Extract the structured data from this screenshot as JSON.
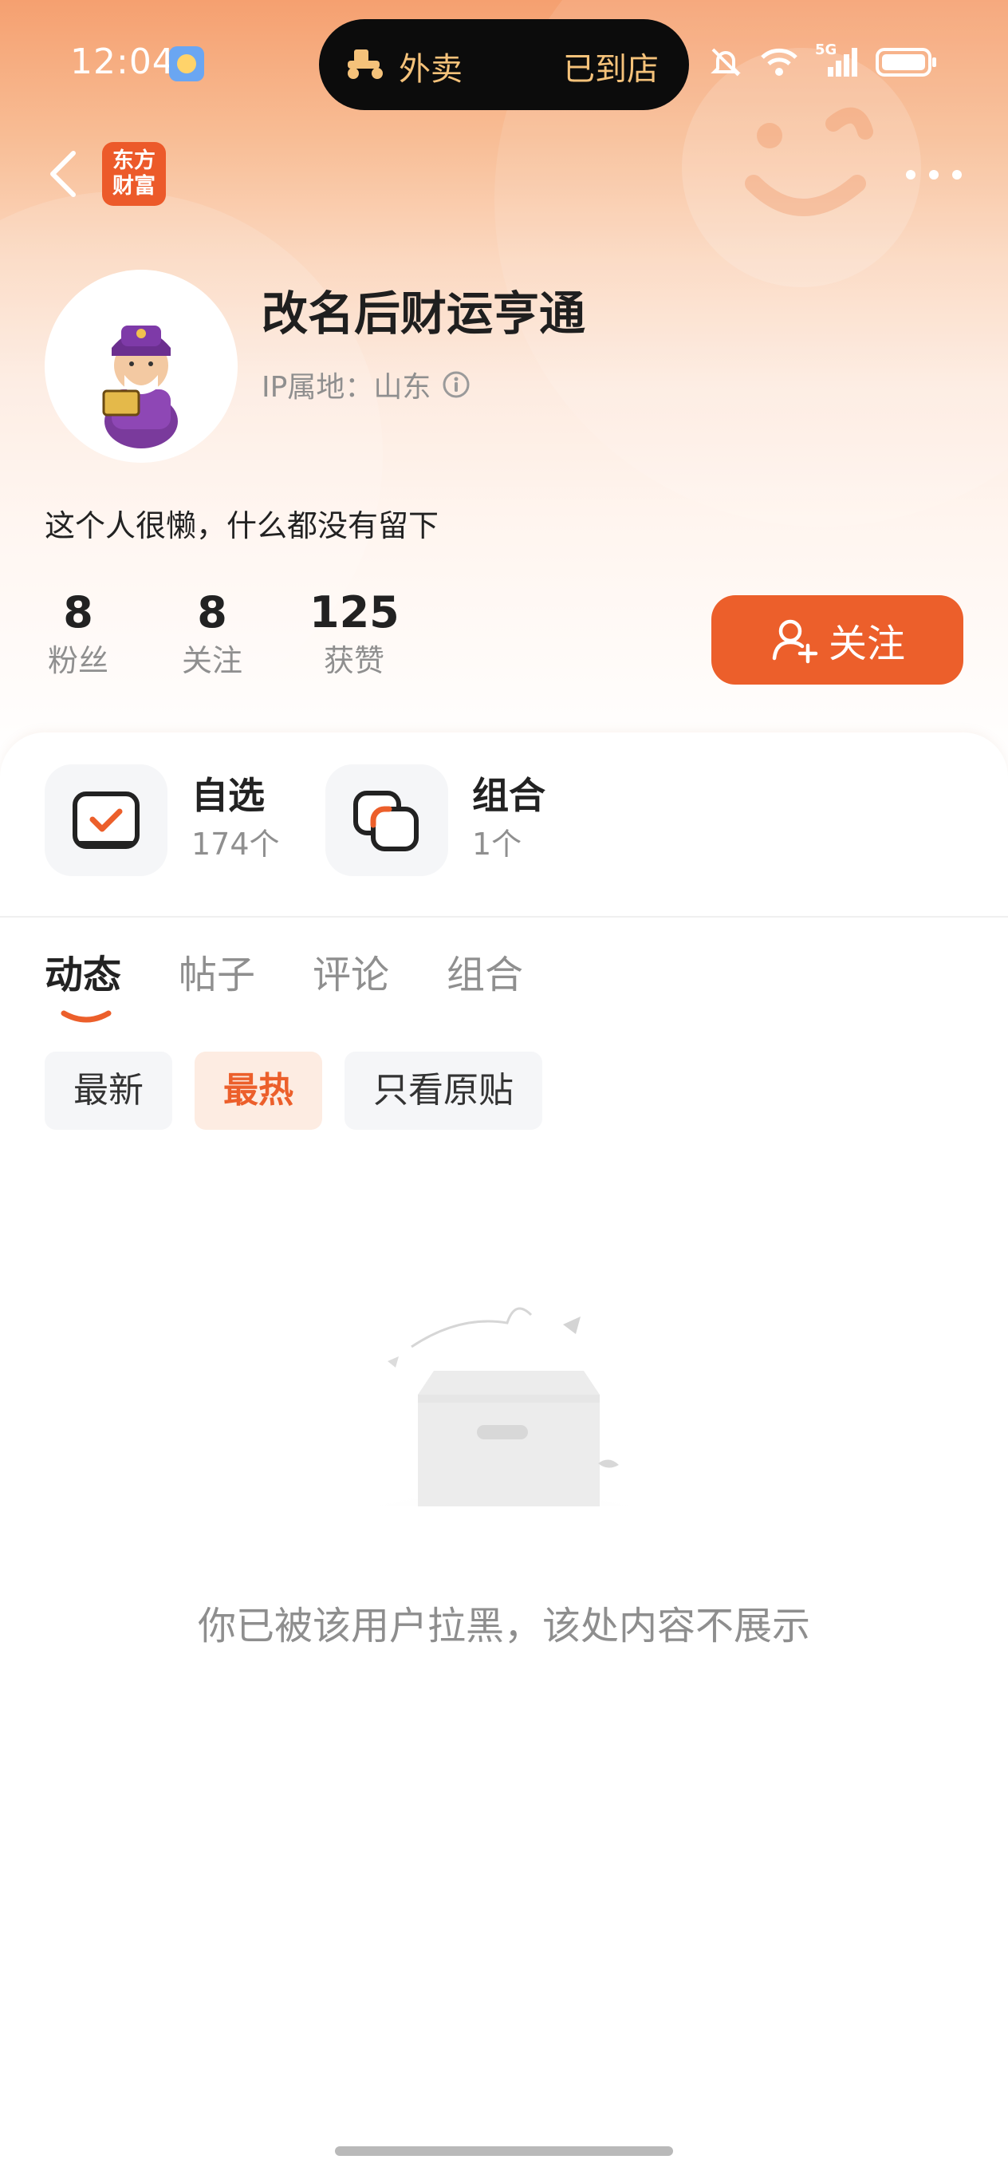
{
  "status_bar": {
    "time": "12:04",
    "island_left": "外卖",
    "island_right": "已到店",
    "network": "5G"
  },
  "nav": {
    "back_icon": "chevron-left-icon",
    "logo_text": "东方财富",
    "more_icon": "more-dots-icon"
  },
  "profile": {
    "username": "改名后财运亨通",
    "ip_location": "IP属地：山东",
    "bio": "这个人很懒，什么都没有留下",
    "stats": [
      {
        "value": "8",
        "label": "粉丝"
      },
      {
        "value": "8",
        "label": "关注"
      },
      {
        "value": "125",
        "label": "获赞"
      }
    ],
    "follow_label": "关注"
  },
  "collections": [
    {
      "title": "自选",
      "count": "174个"
    },
    {
      "title": "组合",
      "count": "1个"
    }
  ],
  "tabs": [
    {
      "label": "动态",
      "active": true
    },
    {
      "label": "帖子",
      "active": false
    },
    {
      "label": "评论",
      "active": false
    },
    {
      "label": "组合",
      "active": false
    }
  ],
  "filters": [
    {
      "label": "最新",
      "active": false
    },
    {
      "label": "最热",
      "active": true
    },
    {
      "label": "只看原贴",
      "active": false
    }
  ],
  "empty_state": {
    "message": "你已被该用户拉黑，该处内容不展示"
  },
  "colors": {
    "accent": "#ec5f2b",
    "muted_text": "#8f8f8f"
  }
}
